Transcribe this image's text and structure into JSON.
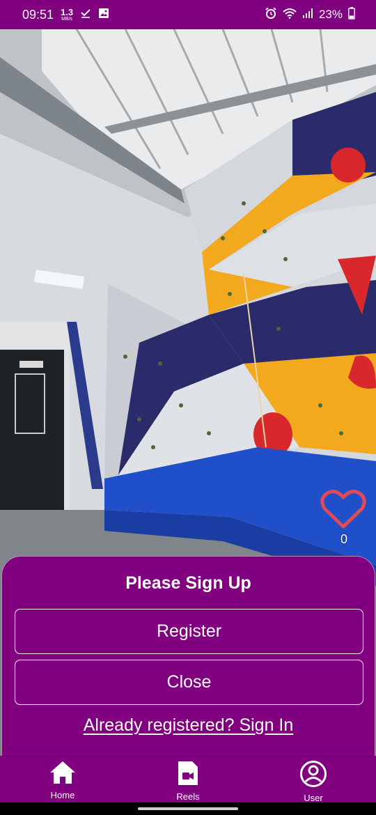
{
  "status_bar": {
    "time": "09:51",
    "net_speed_value": "1.3",
    "net_speed_unit": "MB/s",
    "battery_percent": "23%",
    "icons": [
      "check-icon",
      "gallery-icon",
      "alarm-icon",
      "wifi-icon",
      "signal-icon",
      "battery-icon"
    ]
  },
  "video": {
    "like_count": "0"
  },
  "signup_sheet": {
    "title": "Please Sign Up",
    "register_label": "Register",
    "close_label": "Close",
    "signin_link": "Already registered? Sign In"
  },
  "bottom_nav": {
    "items": [
      {
        "label": "Home",
        "icon": "home-icon"
      },
      {
        "label": "Reels",
        "icon": "reels-icon"
      },
      {
        "label": "User",
        "icon": "user-icon"
      }
    ]
  },
  "colors": {
    "brand": "#800080",
    "text": "#ffffff",
    "like": "#e04b57",
    "accent_square": "#1e88e5"
  }
}
